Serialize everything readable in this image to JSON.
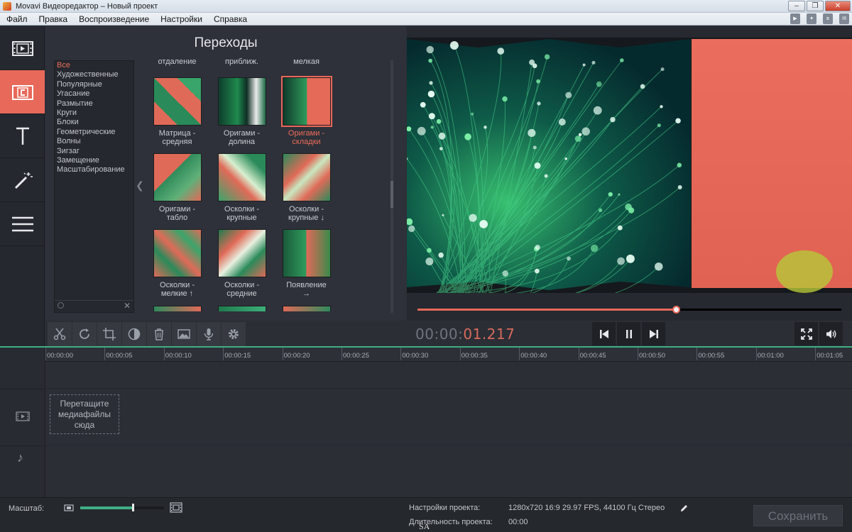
{
  "window": {
    "title": "Movavi Видеоредактор – Новый проект"
  },
  "menu": [
    "Файл",
    "Правка",
    "Воспроизведение",
    "Настройки",
    "Справка"
  ],
  "transitions": {
    "title": "Переходы",
    "categories": [
      "Все",
      "Художественные",
      "Популярные",
      "Угасание",
      "Размытие",
      "Круги",
      "Блоки",
      "Геометрические",
      "Волны",
      "Зигзаг",
      "Замещение",
      "Масштабирование"
    ],
    "active_category": "Все",
    "partial_top_labels": [
      "отдаление",
      "приближ.",
      "мелкая"
    ],
    "tiles": [
      {
        "label": "Матрица -\nсредняя",
        "selected": false
      },
      {
        "label": "Оригами -\nдолина",
        "selected": false
      },
      {
        "label": "Оригами -\nскладки",
        "selected": true
      },
      {
        "label": "Оригами -\nтабло",
        "selected": false
      },
      {
        "label": "Осколки -\nкрупные",
        "selected": false
      },
      {
        "label": "Осколки -\nкрупные ↓",
        "selected": false
      },
      {
        "label": "Осколки -\nмелкие ↑",
        "selected": false
      },
      {
        "label": "Осколки -\nсредние",
        "selected": false
      },
      {
        "label": "Появление\n→",
        "selected": false
      }
    ]
  },
  "player": {
    "timecode_prefix": "00:00:",
    "timecode_value": "01.217",
    "progress_fraction": 0.61
  },
  "timeline": {
    "ticks": [
      "00:00:00",
      "00:00:05",
      "00:00:10",
      "00:00:15",
      "00:00:20",
      "00:00:25",
      "00:00:30",
      "00:00:35",
      "00:00:40",
      "00:00:45",
      "00:00:50",
      "00:00:55",
      "00:01:00",
      "00:01:05"
    ],
    "drop_hint": "Перетащите медиафайлы сюда"
  },
  "bottom": {
    "scale_label": "Масштаб:",
    "zoom_fraction": 0.63,
    "project_settings_label": "Настройки проекта:",
    "project_settings_value": "1280x720 16:9 29.97 FPS, 44100 Гц Стерео",
    "duration_label": "Длительность проекта:",
    "duration_value": "00:00",
    "save_label": "Сохранить",
    "watermark": "SA"
  },
  "colors": {
    "accent": "#e8695a",
    "timeline_green": "#3fae86"
  }
}
